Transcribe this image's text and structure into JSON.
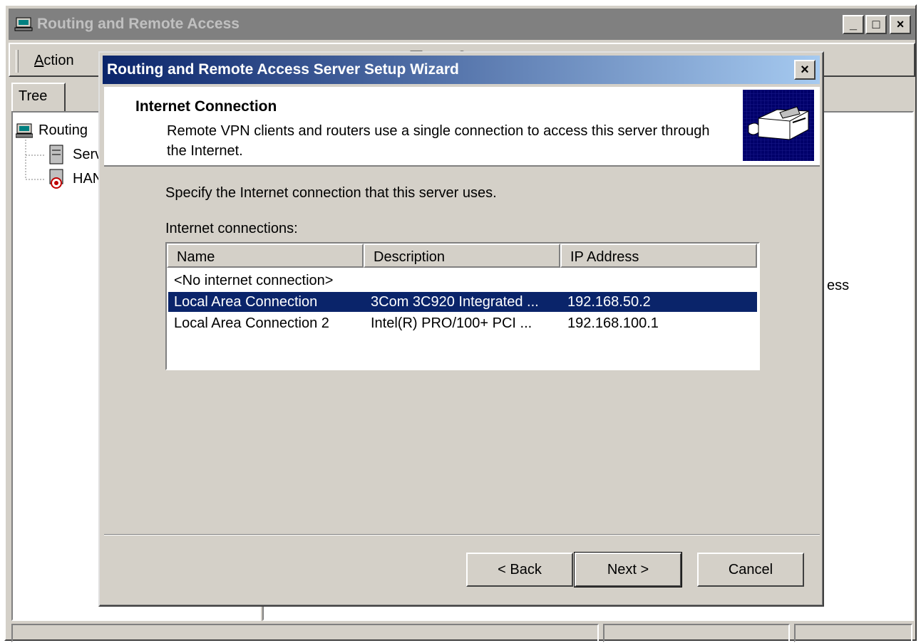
{
  "main_window": {
    "title": "Routing and Remote Access",
    "controls": {
      "minimize": "_",
      "maximize": "□",
      "close": "×"
    },
    "menu": {
      "action_u": "A",
      "action_rest": "ction"
    },
    "tree_tab": "Tree",
    "tree": {
      "root_label": "Routing",
      "child1_label": "Serv",
      "child2_label": "HAN"
    },
    "right_pane_fragment": "ess"
  },
  "wizard": {
    "title": "Routing and Remote Access Server Setup Wizard",
    "close_glyph": "×",
    "header": {
      "title": "Internet Connection",
      "description": "Remote VPN clients and routers use a single connection to access this server through the Internet."
    },
    "instruction": "Specify the Internet connection that this server uses.",
    "list_label": "Internet connections:",
    "columns": [
      "Name",
      "Description",
      "IP Address"
    ],
    "rows": [
      {
        "name": "<No internet connection>",
        "description": "",
        "ip": ""
      },
      {
        "name": "Local Area Connection",
        "description": "3Com 3C920 Integrated ...",
        "ip": "192.168.50.2",
        "selected": true
      },
      {
        "name": "Local Area Connection 2",
        "description": "Intel(R) PRO/100+ PCI ...",
        "ip": "192.168.100.1"
      }
    ],
    "buttons": {
      "back": "< Back",
      "next": "Next >",
      "cancel": "Cancel"
    }
  },
  "colors": {
    "active_title_start": "#0a246a",
    "active_title_end": "#a6caf0",
    "inactive_title": "#808080",
    "selection": "#0a246a",
    "face": "#d4d0c8"
  }
}
